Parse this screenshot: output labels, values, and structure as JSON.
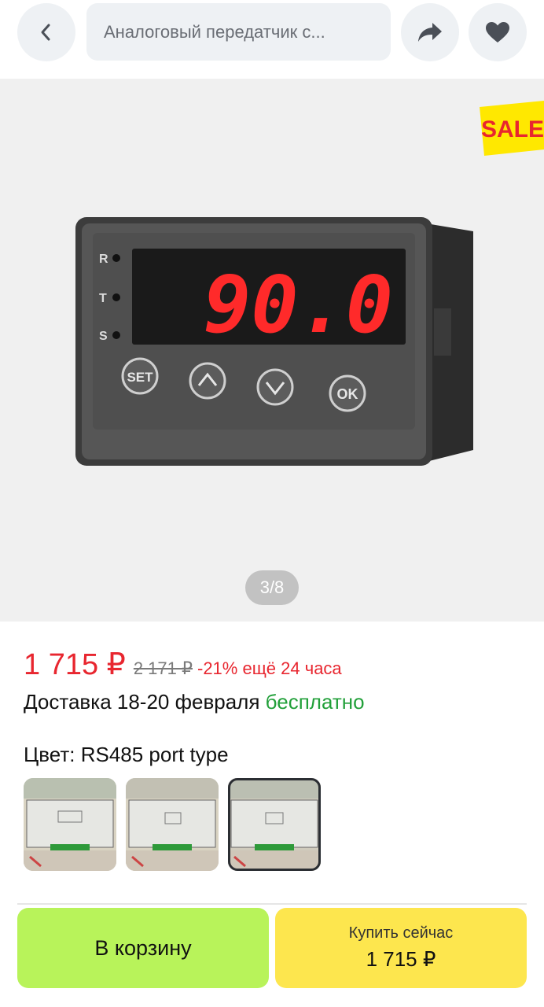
{
  "header": {
    "search_text": "Аналоговый передатчик с..."
  },
  "gallery": {
    "page_indicator": "3/8",
    "sale_badge": "SALE",
    "device": {
      "display_value": "90.0",
      "indicators": [
        "R",
        "T",
        "S"
      ],
      "buttons": [
        "SET",
        "OK"
      ]
    }
  },
  "price": {
    "current": "1 715 ₽",
    "old": "2 171 ₽",
    "discount": "-21% ещё 24 часа"
  },
  "delivery": {
    "text": "Доставка 18-20 февраля",
    "free": "бесплатно"
  },
  "color": {
    "label": "Цвет: RS485 port type",
    "selected_index": 2
  },
  "actions": {
    "cart_label": "В корзину",
    "buy_label": "Купить сейчас",
    "buy_price": "1 715 ₽"
  },
  "colors": {
    "price_red": "#e8262f",
    "free_green": "#22a03a",
    "cart_green": "#b8f35a",
    "buy_yellow": "#fde64e"
  }
}
